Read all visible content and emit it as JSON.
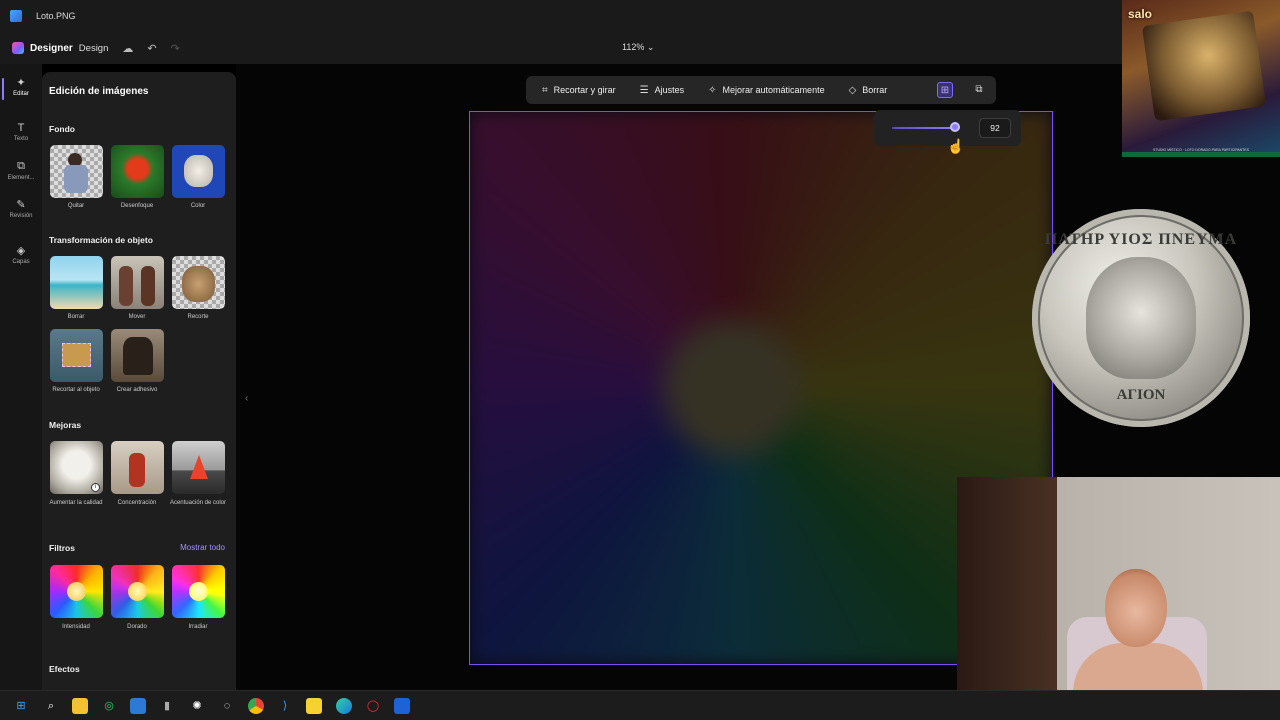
{
  "window": {
    "file_name": "Loto.PNG"
  },
  "header": {
    "brand": "Designer",
    "mode": "Design",
    "zoom": "112%"
  },
  "rail": [
    {
      "label": "Editar",
      "icon": "sparkle-icon"
    },
    {
      "label": "Texto",
      "icon": "text-icon"
    },
    {
      "label": "Element...",
      "icon": "shapes-icon"
    },
    {
      "label": "Revisión",
      "icon": "pen-icon"
    },
    {
      "label": "Capas",
      "icon": "layers-icon"
    }
  ],
  "panel": {
    "title": "Edición de imágenes",
    "sections": {
      "fondo": {
        "title": "Fondo",
        "items": [
          "Quitar",
          "Desenfoque",
          "Color"
        ]
      },
      "transform": {
        "title": "Transformación de objeto",
        "items": [
          "Borrar",
          "Mover",
          "Recorte",
          "Recortar al objeto",
          "Crear adhesivo"
        ]
      },
      "mejoras": {
        "title": "Mejoras",
        "items": [
          "Aumentar la calidad",
          "Concentración",
          "Acentuación de color"
        ]
      },
      "filtros": {
        "title": "Filtros",
        "link": "Mostrar todo",
        "items": [
          "Intensidad",
          "Dorado",
          "Irradiar"
        ]
      },
      "efectos": {
        "title": "Efectos"
      }
    }
  },
  "toolbar": {
    "crop": "Recortar y girar",
    "adjust": "Ajustes",
    "auto": "Mejorar automáticamente",
    "erase": "Borrar"
  },
  "opacity_slider": {
    "value": "92",
    "fraction": 0.92
  },
  "overlay": {
    "channel": "salo",
    "caption": "STUDIO MÍSTICO · LOTO DORADO PARA PARTICIPANTES",
    "coin_top": "ΠΑΤΗΡ ΥΙΟΣ ΠΝΕΥΜΑ",
    "coin_bottom": "ΑΓΙΟΝ"
  },
  "taskbar": [
    "windows-start-icon",
    "search-icon",
    "file-explorer-icon",
    "whatsapp-icon",
    "store-icon",
    "usb-icon",
    "chatgpt-icon",
    "app-icon",
    "chrome-icon",
    "vscode-icon",
    "sticky-notes-icon",
    "edge-icon",
    "opera-icon",
    "designer-icon"
  ]
}
